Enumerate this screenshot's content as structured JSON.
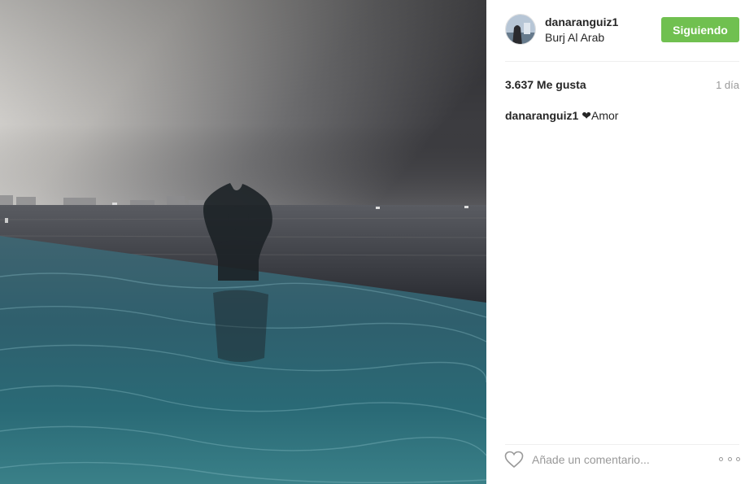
{
  "post": {
    "username": "danaranguiz1",
    "location": "Burj Al Arab",
    "follow_label": "Siguiendo",
    "likes": "3.637 Me gusta",
    "time": "1 día",
    "caption_user": "danaranguiz1",
    "caption_heart": "❤",
    "caption_text": "Amor",
    "comment_placeholder": "Añade un comentario..."
  },
  "icons": {
    "like": "heart-outline-icon",
    "more": "ellipsis-icon"
  },
  "colors": {
    "follow_button": "#70c050",
    "text": "#262626",
    "muted": "#999999"
  }
}
